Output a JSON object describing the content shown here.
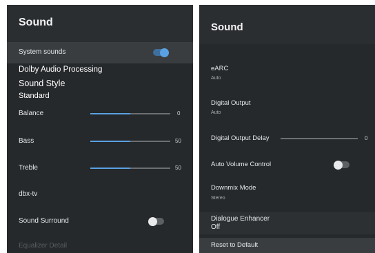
{
  "left": {
    "title": "Sound",
    "system_sounds": {
      "label": "System sounds",
      "on": true
    },
    "dolby_audio_processing": "Dolby Audio Processing",
    "sound_style": {
      "label": "Sound Style",
      "value": "Standard"
    },
    "balance": {
      "label": "Balance",
      "value": "0",
      "level": 0.5
    },
    "bass": {
      "label": "Bass",
      "value": "50",
      "level": 0.5
    },
    "treble": {
      "label": "Treble",
      "value": "50",
      "level": 0.5
    },
    "dbx_tv": "dbx-tv",
    "sound_surround": {
      "label": "Sound Surround",
      "on": false
    },
    "equalizer_detail": "Equalizer Detail"
  },
  "right": {
    "title": "Sound",
    "earc": {
      "label": "eARC",
      "value": "Auto"
    },
    "digital_output": {
      "label": "Digital Output",
      "value": "Auto"
    },
    "digital_output_delay": {
      "label": "Digital Output Delay",
      "value": "0",
      "level": 0
    },
    "auto_volume_control": {
      "label": "Auto Volume Control",
      "on": false
    },
    "downmix_mode": {
      "label": "Downmix Mode",
      "value": "Stereo"
    },
    "dialogue_enhancer": {
      "label": "Dialogue Enhancer",
      "value": "Off"
    },
    "reset": "Reset to Default"
  },
  "colors": {
    "accent": "#5aa1e3",
    "panel": "#26292b",
    "header": "#2b2e30",
    "selected": "#3a3d40"
  }
}
